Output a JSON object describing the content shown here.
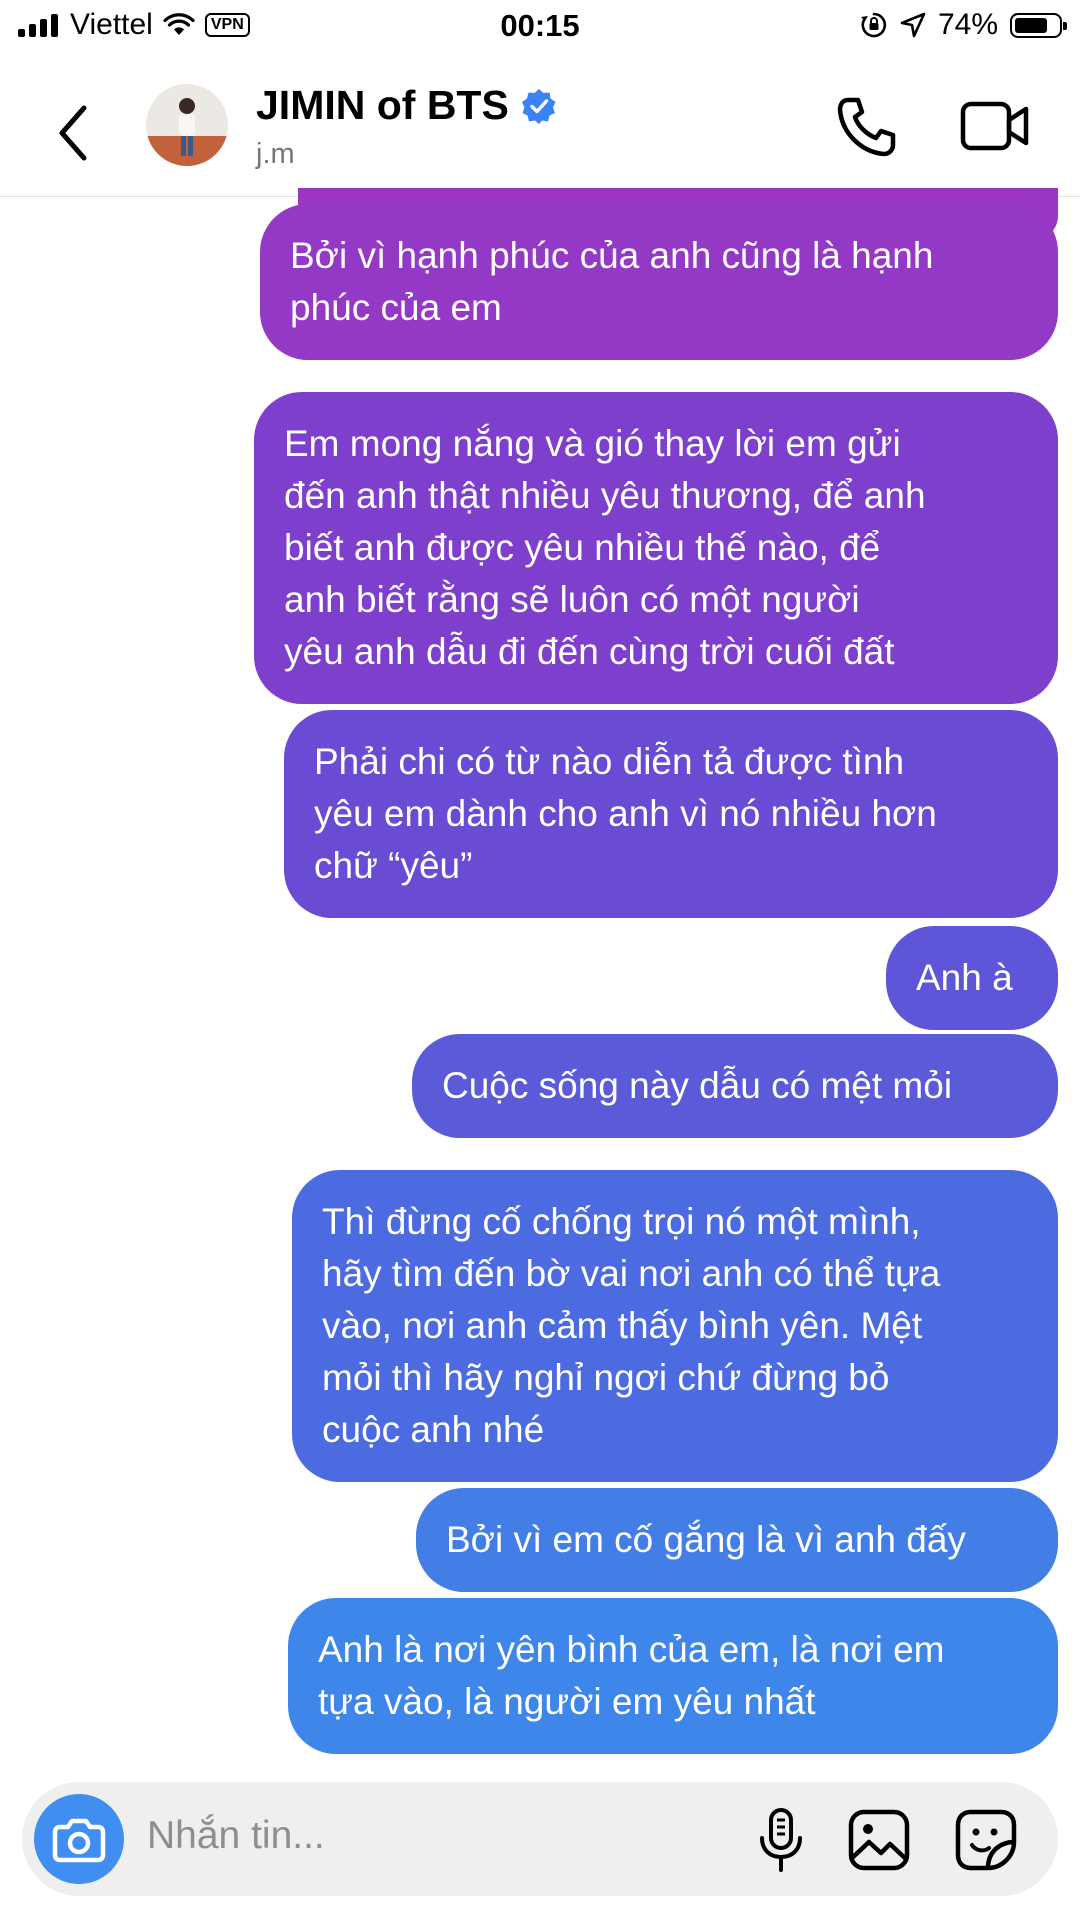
{
  "status_bar": {
    "carrier": "Viettel",
    "vpn": "VPN",
    "time": "00:15",
    "battery_pct": "74%"
  },
  "header": {
    "name": "JIMIN of BTS",
    "username": "j.m",
    "verified_color": "#3b82f6"
  },
  "messages": [
    {
      "lines": [
        "Bởi vì hạnh phúc của anh cũng là hạnh",
        "phúc của em"
      ],
      "color": "#9339c6"
    },
    {
      "lines": [
        "Em mong nắng và gió thay lời em gửi",
        "đến anh thật nhiều yêu thương, để anh",
        "biết anh được yêu nhiều thế nào, để",
        "anh biết rằng sẽ luôn có một người",
        "yêu anh dẫu đi đến cùng trời cuối đất"
      ],
      "color": "#7e40cc"
    },
    {
      "lines": [
        "Phải chi có từ nào diễn tả được tình",
        "yêu em dành cho anh vì nó nhiều hơn",
        "chữ “yêu”"
      ],
      "color": "#6a4bd3"
    },
    {
      "lines": [
        "Anh à"
      ],
      "color": "#5f55d8"
    },
    {
      "lines": [
        "Cuộc sống này dẫu có mệt mỏi"
      ],
      "color": "#5b5ad9"
    },
    {
      "lines": [
        "Thì đừng cố chống trọi nó một mình,",
        "hãy tìm đến bờ vai nơi anh có thể tựa",
        "vào, nơi anh cảm thấy bình yên. Mệt",
        "mỏi thì hãy nghỉ ngơi chứ đừng bỏ",
        "cuộc anh nhé"
      ],
      "color": "#4d6be0"
    },
    {
      "lines": [
        "Bởi vì em cố gắng là vì anh đấy"
      ],
      "color": "#437ee6"
    },
    {
      "lines": [
        "Anh là nơi yên bình của em, là nơi em",
        "tựa vào, là người em yêu nhất"
      ],
      "color": "#3e86ea"
    }
  ],
  "composer": {
    "placeholder": "Nhắn tin...",
    "camera_color": "#3f8ef0"
  }
}
